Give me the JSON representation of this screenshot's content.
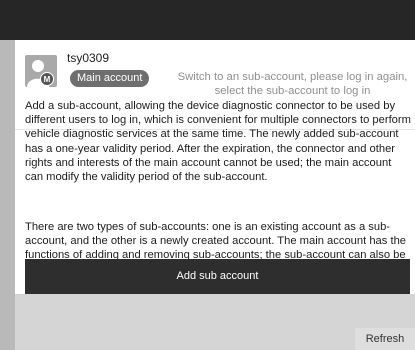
{
  "account": {
    "username": "tsy0309",
    "badge": "Main account",
    "switch_hint": "Switch to an sub-account, please log in again, select the sub-account to log in",
    "avatar_letter": "M"
  },
  "description": {
    "paragraph_1": "Add a sub-account, allowing the device diagnostic connector to be used by different users to log in, which is convenient for multiple connectors to perform vehicle diagnostic services at the same time. The newly added sub-account has a one-year validity period. After the expiration, the connector and other rights and interests of the main account cannot be used; the main account can modify the validity period of the sub-account.",
    "paragraph_2": "There are two types of sub-accounts: one is an existing account as a sub-account, and the other is a newly created account. The main account has the functions of adding and removing sub-accounts; the sub-account can also be unbound with the main account."
  },
  "actions": {
    "add_label": "Add sub account",
    "refresh_label": "Refresh"
  },
  "colors": {
    "top_bar": "#262626",
    "button": "#2e2e2e",
    "badge": "#6e6e6e",
    "hint_text": "#8f8f8f"
  }
}
